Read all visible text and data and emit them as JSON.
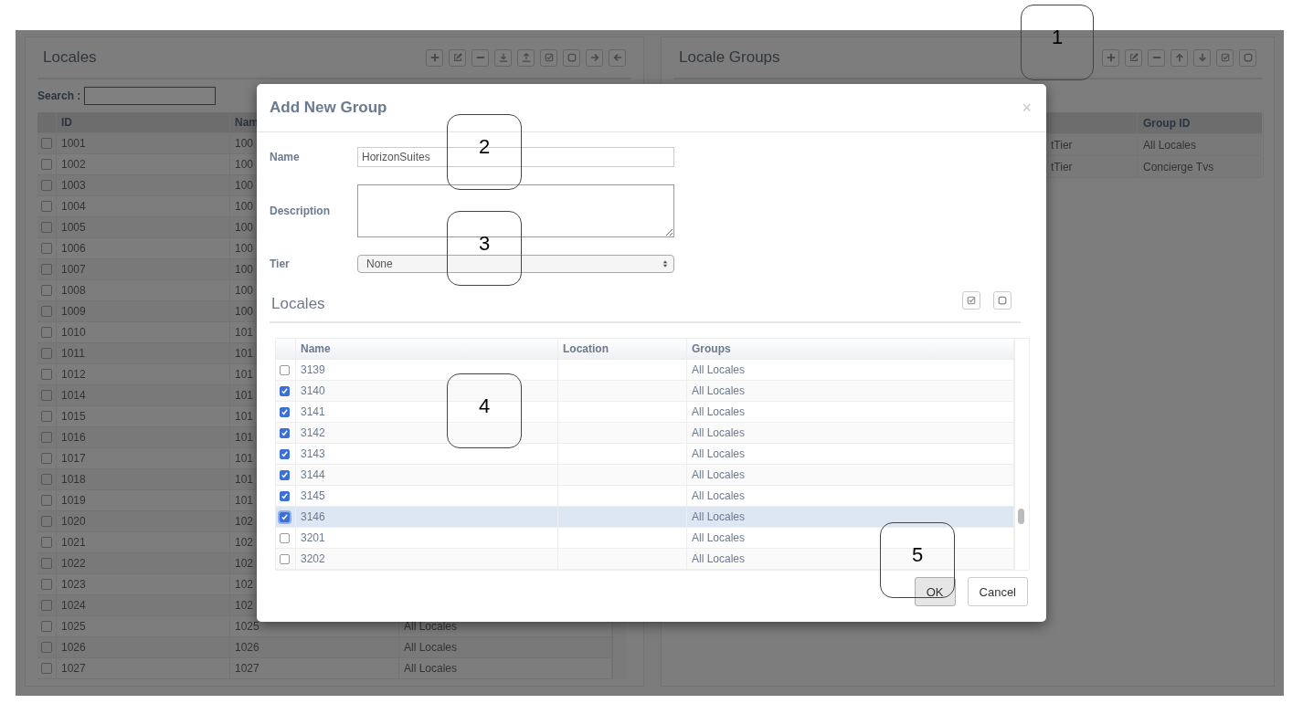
{
  "locales_panel": {
    "title": "Locales",
    "toolbar": [
      {
        "kind": "plus"
      },
      {
        "kind": "edit"
      },
      {
        "kind": "minus"
      },
      {
        "kind": "import"
      },
      {
        "kind": "export"
      },
      {
        "kind": "check"
      },
      {
        "kind": "square"
      },
      {
        "kind": "right"
      },
      {
        "kind": "left"
      }
    ],
    "search_label": "Search :",
    "columns": [
      "ID",
      "Nam"
    ],
    "rows": [
      {
        "checked": false,
        "id": "1001",
        "name": "100"
      },
      {
        "checked": false,
        "id": "1002",
        "name": "100"
      },
      {
        "checked": false,
        "id": "1003",
        "name": "100"
      },
      {
        "checked": false,
        "id": "1004",
        "name": "100"
      },
      {
        "checked": false,
        "id": "1005",
        "name": "100"
      },
      {
        "checked": false,
        "id": "1006",
        "name": "100"
      },
      {
        "checked": false,
        "id": "1007",
        "name": "100"
      },
      {
        "checked": false,
        "id": "1008",
        "name": "100"
      },
      {
        "checked": false,
        "id": "1009",
        "name": "100"
      },
      {
        "checked": false,
        "id": "1010",
        "name": "101"
      },
      {
        "checked": false,
        "id": "1011",
        "name": "101"
      },
      {
        "checked": false,
        "id": "1012",
        "name": "101"
      },
      {
        "checked": false,
        "id": "1014",
        "name": "101"
      },
      {
        "checked": false,
        "id": "1015",
        "name": "101"
      },
      {
        "checked": false,
        "id": "1016",
        "name": "101"
      },
      {
        "checked": false,
        "id": "1017",
        "name": "101"
      },
      {
        "checked": false,
        "id": "1018",
        "name": "101"
      },
      {
        "checked": false,
        "id": "1019",
        "name": "101"
      },
      {
        "checked": false,
        "id": "1020",
        "name": "102"
      },
      {
        "checked": false,
        "id": "1021",
        "name": "102"
      },
      {
        "checked": false,
        "id": "1022",
        "name": "102"
      },
      {
        "checked": false,
        "id": "1023",
        "name": "102"
      },
      {
        "checked": false,
        "id": "1024",
        "name": "102"
      },
      {
        "checked": false,
        "id": "1025",
        "name": "1025",
        "groups": "All Locales"
      },
      {
        "checked": false,
        "id": "1026",
        "name": "1026",
        "groups": "All Locales"
      },
      {
        "checked": false,
        "id": "1027",
        "name": "1027",
        "groups": "All Locales"
      }
    ]
  },
  "groups_panel": {
    "title": "Locale Groups",
    "toolbar": [
      {
        "kind": "plus"
      },
      {
        "kind": "edit"
      },
      {
        "kind": "minus"
      },
      {
        "kind": "up"
      },
      {
        "kind": "down"
      },
      {
        "kind": "check"
      },
      {
        "kind": "square"
      }
    ],
    "columns": [
      "Group ID"
    ],
    "rows": [
      {
        "column_1": "tTier",
        "group_id": "All Locales"
      },
      {
        "column_1": "tTier",
        "group_id": "Concierge Tvs"
      }
    ]
  },
  "dialog": {
    "title": "Add New Group",
    "close": "×",
    "name_label": "Name",
    "name_value": "HorizonSuites",
    "description_label": "Description",
    "tier_label": "Tier",
    "tier_value": "None",
    "section_title": "Locales",
    "section_toolbar": [
      {
        "kind": "check"
      },
      {
        "kind": "square"
      }
    ],
    "columns": [
      "Name",
      "Location",
      "Groups"
    ],
    "rows": [
      {
        "checked": false,
        "selected": false,
        "name": "3139",
        "groups": "All Locales"
      },
      {
        "checked": true,
        "selected": false,
        "name": "3140",
        "groups": "All Locales"
      },
      {
        "checked": true,
        "selected": false,
        "name": "3141",
        "groups": "All Locales"
      },
      {
        "checked": true,
        "selected": false,
        "name": "3142",
        "groups": "All Locales"
      },
      {
        "checked": true,
        "selected": false,
        "name": "3143",
        "groups": "All Locales"
      },
      {
        "checked": true,
        "selected": false,
        "name": "3144",
        "groups": "All Locales"
      },
      {
        "checked": true,
        "selected": false,
        "name": "3145",
        "groups": "All Locales"
      },
      {
        "checked": true,
        "selected": true,
        "name": "3146",
        "groups": "All Locales"
      },
      {
        "checked": false,
        "selected": false,
        "name": "3201",
        "groups": "All Locales"
      },
      {
        "checked": false,
        "selected": false,
        "name": "3202",
        "groups": "All Locales"
      }
    ],
    "buttons": [
      {
        "label": "OK",
        "pressed": true
      },
      {
        "label": "Cancel",
        "pressed": false
      }
    ]
  },
  "callouts": [
    "1",
    "2",
    "3",
    "4",
    "5"
  ]
}
